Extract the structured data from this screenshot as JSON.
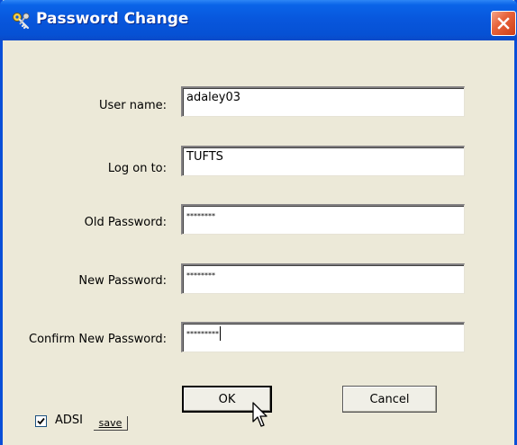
{
  "window": {
    "title": "Password Change",
    "icon": "keys-icon",
    "close_icon": "close-icon",
    "titlebar_color": "#0a5ae0",
    "body_color": "#ece9d8"
  },
  "form": {
    "fields": [
      {
        "label": "User name:",
        "value": "adaley03",
        "masked": false
      },
      {
        "label": "Log on to:",
        "value": "TUFTS",
        "masked": false
      },
      {
        "label": "Old Password:",
        "value": "********",
        "masked": true
      },
      {
        "label": "New Password:",
        "value": "********",
        "masked": true
      },
      {
        "label": "Confirm New Password:",
        "value": "*********",
        "masked": true,
        "focused": true
      }
    ]
  },
  "buttons": {
    "ok_label": "OK",
    "cancel_label": "Cancel"
  },
  "options": {
    "adsi_label": "ADSI",
    "adsi_checked": true,
    "save_label": "save"
  }
}
